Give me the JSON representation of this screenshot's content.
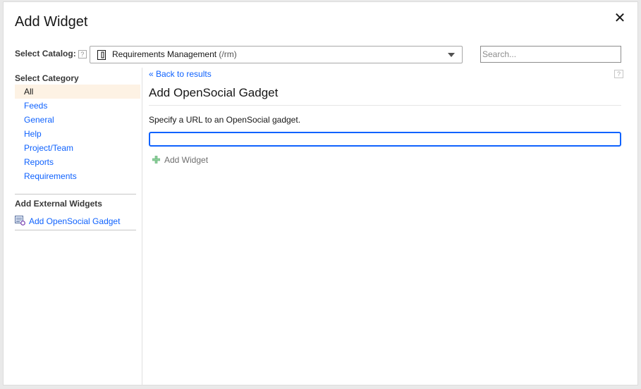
{
  "dialog": {
    "title": "Add Widget",
    "close_glyph": "✕"
  },
  "catalog": {
    "label": "Select Catalog:",
    "help_glyph": "?",
    "selected_name": "Requirements Management",
    "selected_path": "(/rm)"
  },
  "search": {
    "placeholder": "Search...",
    "value": ""
  },
  "sidebar": {
    "category_heading": "Select Category",
    "categories": [
      {
        "label": "All",
        "selected": true
      },
      {
        "label": "Feeds"
      },
      {
        "label": "General"
      },
      {
        "label": "Help"
      },
      {
        "label": "Project/Team"
      },
      {
        "label": "Reports"
      },
      {
        "label": "Requirements"
      }
    ],
    "external_heading": "Add External Widgets",
    "external_item": "Add OpenSocial Gadget"
  },
  "main": {
    "back_link": "« Back to results",
    "help_glyph": "?",
    "title": "Add OpenSocial Gadget",
    "instructions": "Specify a URL to an OpenSocial gadget.",
    "url_value": "",
    "add_button": "Add Widget"
  },
  "colors": {
    "link": "#0f62fe",
    "selected_bg": "#fdf2e4",
    "focus_border": "#0f62fe"
  }
}
